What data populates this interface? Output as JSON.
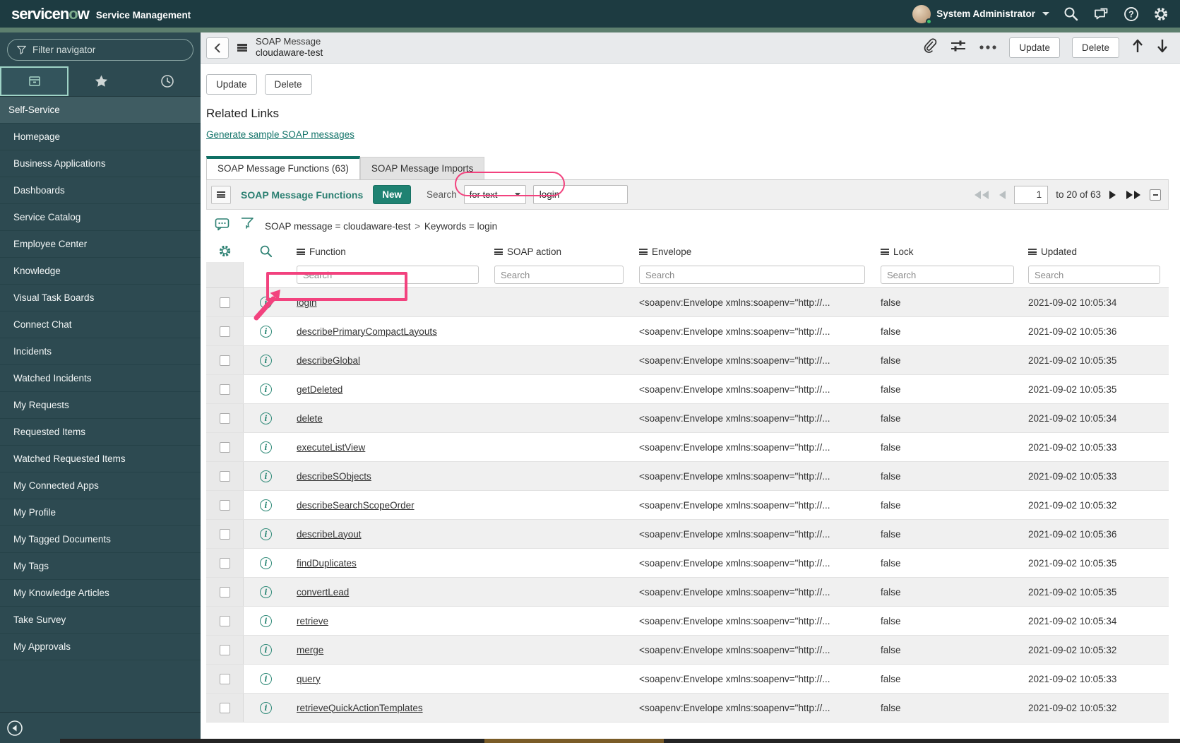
{
  "colors": {
    "banner_bg": "#1d3b41",
    "accent_teal": "#1f8272",
    "link_teal": "#14746a",
    "annotation_pink": "#f2427e",
    "sidebar_bg": "#2d4a51"
  },
  "banner": {
    "brand_prefix": "servicen",
    "brand_o": "o",
    "brand_suffix": "w",
    "app_name": "Service Management",
    "user_name": "System Administrator"
  },
  "sidebar": {
    "filter_placeholder": "Filter navigator",
    "section_header": "Self-Service",
    "items": [
      "Homepage",
      "Business Applications",
      "Dashboards",
      "Service Catalog",
      "Employee Center",
      "Knowledge",
      "Visual Task Boards",
      "Connect Chat",
      "Incidents",
      "Watched Incidents",
      "My Requests",
      "Requested Items",
      "Watched Requested Items",
      "My Connected Apps",
      "My Profile",
      "My Tagged Documents",
      "My Tags",
      "My Knowledge Articles",
      "Take Survey",
      "My Approvals"
    ]
  },
  "form_header": {
    "title": "SOAP Message",
    "subtitle": "cloudaware-test",
    "update_label": "Update",
    "delete_label": "Delete"
  },
  "body": {
    "update_label": "Update",
    "delete_label": "Delete",
    "related_links_heading": "Related Links",
    "related_link": "Generate sample SOAP messages",
    "tab_active": "SOAP Message Functions (63)",
    "tab_inactive": "SOAP Message Imports"
  },
  "list": {
    "title": "SOAP Message Functions",
    "new_label": "New",
    "search_label": "Search",
    "search_type": "for text",
    "search_value": "login",
    "pagination": {
      "page": "1",
      "range": "to 20 of 63"
    },
    "breadcrumb": [
      "SOAP message = cloudaware-test",
      "Keywords = login"
    ],
    "breadcrumb_separator": ">",
    "columns": [
      "Function",
      "SOAP action",
      "Envelope",
      "Lock",
      "Updated"
    ],
    "column_search_placeholder": "Search",
    "rows": [
      {
        "function": "login",
        "soap_action": "",
        "envelope": "<soapenv:Envelope xmlns:soapenv=\"http://...",
        "lock": "false",
        "updated": "2021-09-02 10:05:34"
      },
      {
        "function": "describePrimaryCompactLayouts",
        "soap_action": "",
        "envelope": "<soapenv:Envelope xmlns:soapenv=\"http://...",
        "lock": "false",
        "updated": "2021-09-02 10:05:36"
      },
      {
        "function": "describeGlobal",
        "soap_action": "",
        "envelope": "<soapenv:Envelope xmlns:soapenv=\"http://...",
        "lock": "false",
        "updated": "2021-09-02 10:05:35"
      },
      {
        "function": "getDeleted",
        "soap_action": "",
        "envelope": "<soapenv:Envelope xmlns:soapenv=\"http://...",
        "lock": "false",
        "updated": "2021-09-02 10:05:35"
      },
      {
        "function": "delete",
        "soap_action": "",
        "envelope": "<soapenv:Envelope xmlns:soapenv=\"http://...",
        "lock": "false",
        "updated": "2021-09-02 10:05:34"
      },
      {
        "function": "executeListView",
        "soap_action": "",
        "envelope": "<soapenv:Envelope xmlns:soapenv=\"http://...",
        "lock": "false",
        "updated": "2021-09-02 10:05:33"
      },
      {
        "function": "describeSObjects",
        "soap_action": "",
        "envelope": "<soapenv:Envelope xmlns:soapenv=\"http://...",
        "lock": "false",
        "updated": "2021-09-02 10:05:33"
      },
      {
        "function": "describeSearchScopeOrder",
        "soap_action": "",
        "envelope": "<soapenv:Envelope xmlns:soapenv=\"http://...",
        "lock": "false",
        "updated": "2021-09-02 10:05:32"
      },
      {
        "function": "describeLayout",
        "soap_action": "",
        "envelope": "<soapenv:Envelope xmlns:soapenv=\"http://...",
        "lock": "false",
        "updated": "2021-09-02 10:05:36"
      },
      {
        "function": "findDuplicates",
        "soap_action": "",
        "envelope": "<soapenv:Envelope xmlns:soapenv=\"http://...",
        "lock": "false",
        "updated": "2021-09-02 10:05:35"
      },
      {
        "function": "convertLead",
        "soap_action": "",
        "envelope": "<soapenv:Envelope xmlns:soapenv=\"http://...",
        "lock": "false",
        "updated": "2021-09-02 10:05:35"
      },
      {
        "function": "retrieve",
        "soap_action": "",
        "envelope": "<soapenv:Envelope xmlns:soapenv=\"http://...",
        "lock": "false",
        "updated": "2021-09-02 10:05:34"
      },
      {
        "function": "merge",
        "soap_action": "",
        "envelope": "<soapenv:Envelope xmlns:soapenv=\"http://...",
        "lock": "false",
        "updated": "2021-09-02 10:05:32"
      },
      {
        "function": "query",
        "soap_action": "",
        "envelope": "<soapenv:Envelope xmlns:soapenv=\"http://...",
        "lock": "false",
        "updated": "2021-09-02 10:05:33"
      },
      {
        "function": "retrieveQuickActionTemplates",
        "soap_action": "",
        "envelope": "<soapenv:Envelope xmlns:soapenv=\"http://...",
        "lock": "false",
        "updated": "2021-09-02 10:05:32"
      }
    ]
  }
}
